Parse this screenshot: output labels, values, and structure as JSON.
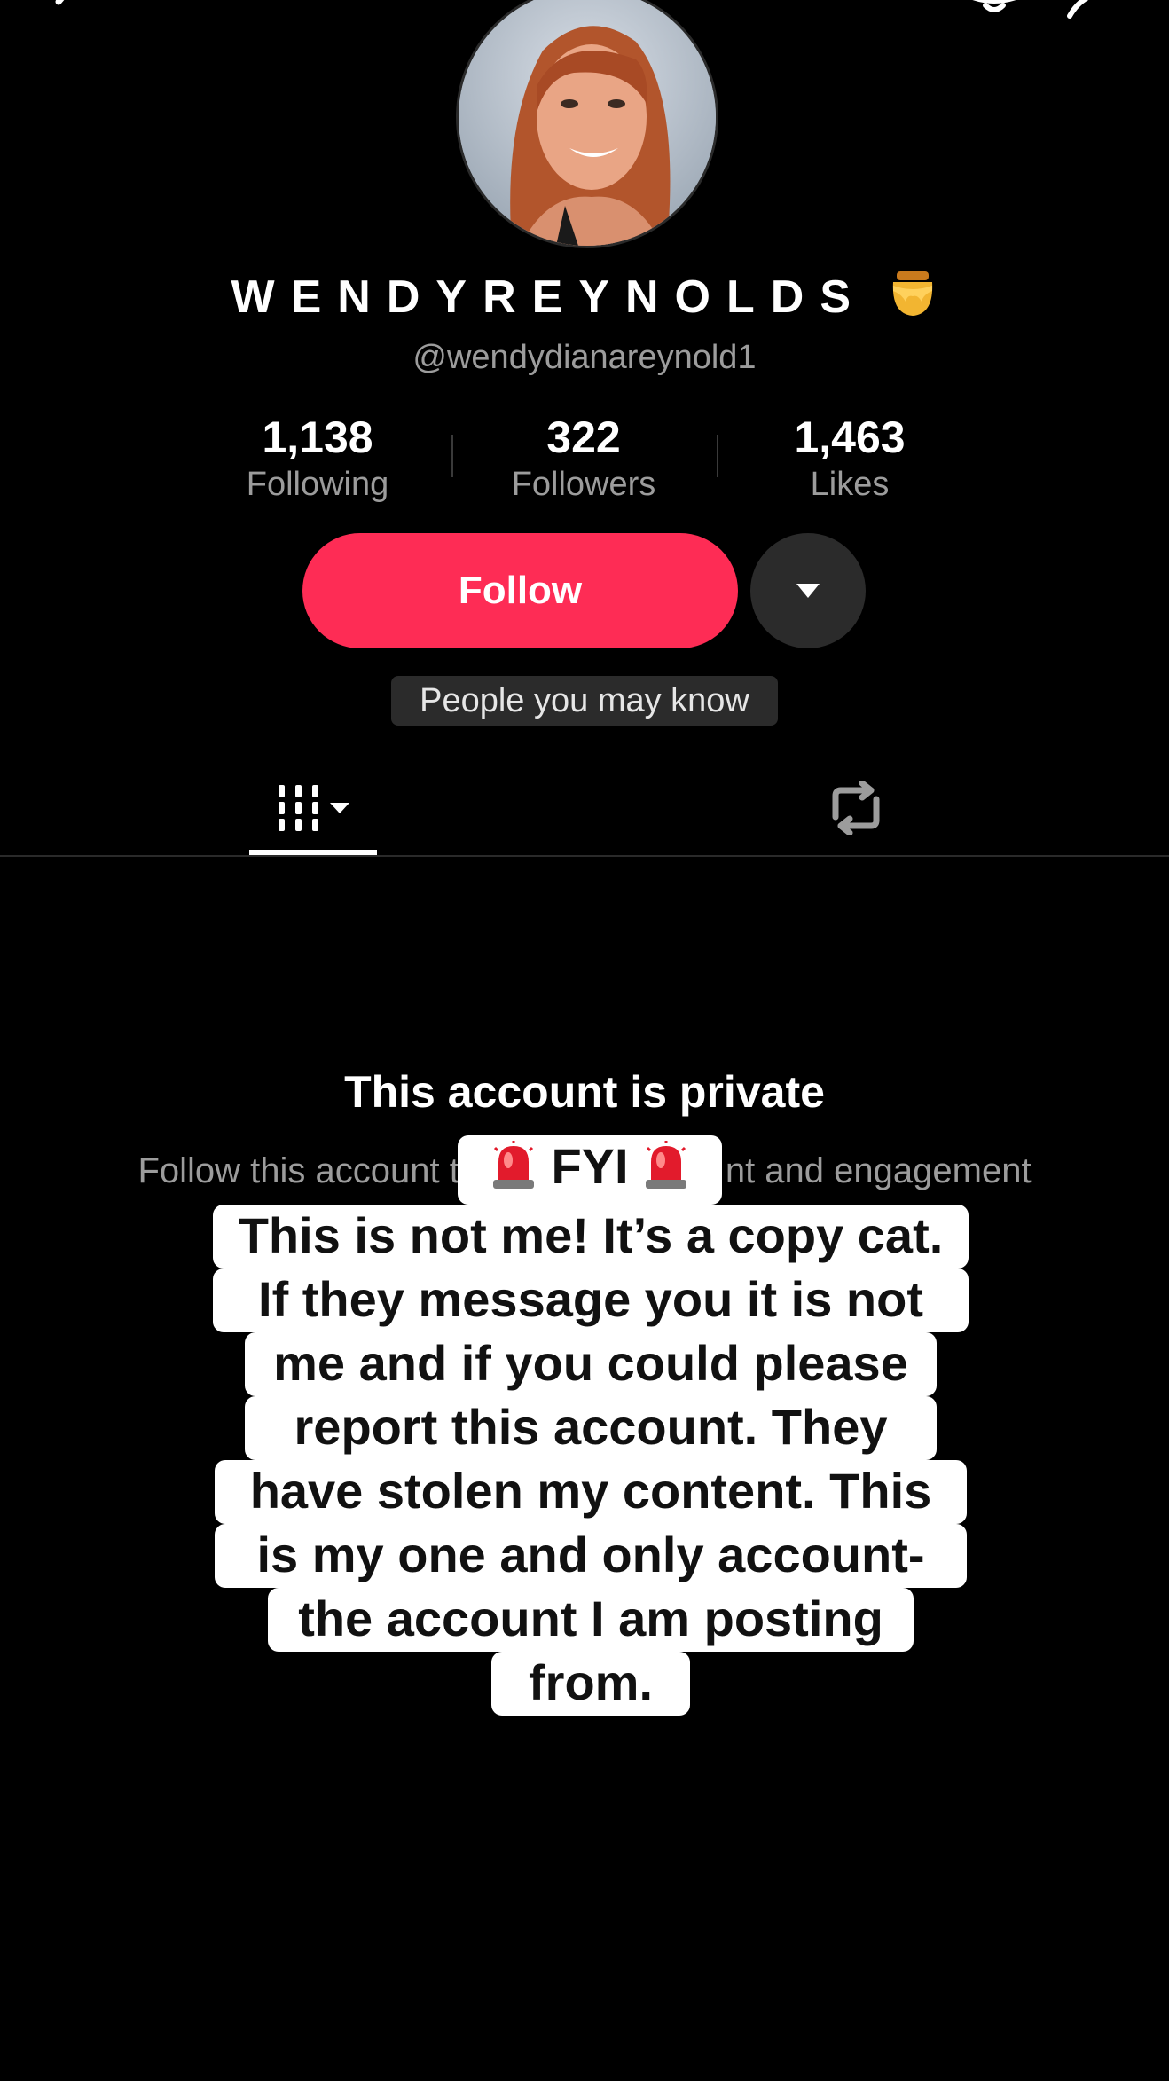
{
  "profile": {
    "display_name": "WENDYREYNOLDS",
    "name_emoji": "honey-pot-icon",
    "handle": "@wendydianareynold1"
  },
  "stats": [
    {
      "value": "1,138",
      "label": "Following"
    },
    {
      "value": "322",
      "label": "Followers"
    },
    {
      "value": "1,463",
      "label": "Likes"
    }
  ],
  "actions": {
    "follow_label": "Follow",
    "people_you_may_know": "People you may know"
  },
  "private_notice": {
    "title": "This account is private",
    "subtitle": "Follow this account t",
    "subtitle_tail": "nt and engagement"
  },
  "overlay": {
    "header": "FYI",
    "lines": [
      "This is not me! It’s a copy cat.",
      "If they message you it is not",
      "me and if you could please",
      "report this account. They",
      "have stolen my content.  This",
      "is my one and only account-",
      "the account I am posting",
      "from."
    ]
  },
  "colors": {
    "background": "#000000",
    "follow_button": "#fe2c55",
    "secondary_text": "#9c9c9c",
    "chip_background": "#2b2b2b"
  }
}
